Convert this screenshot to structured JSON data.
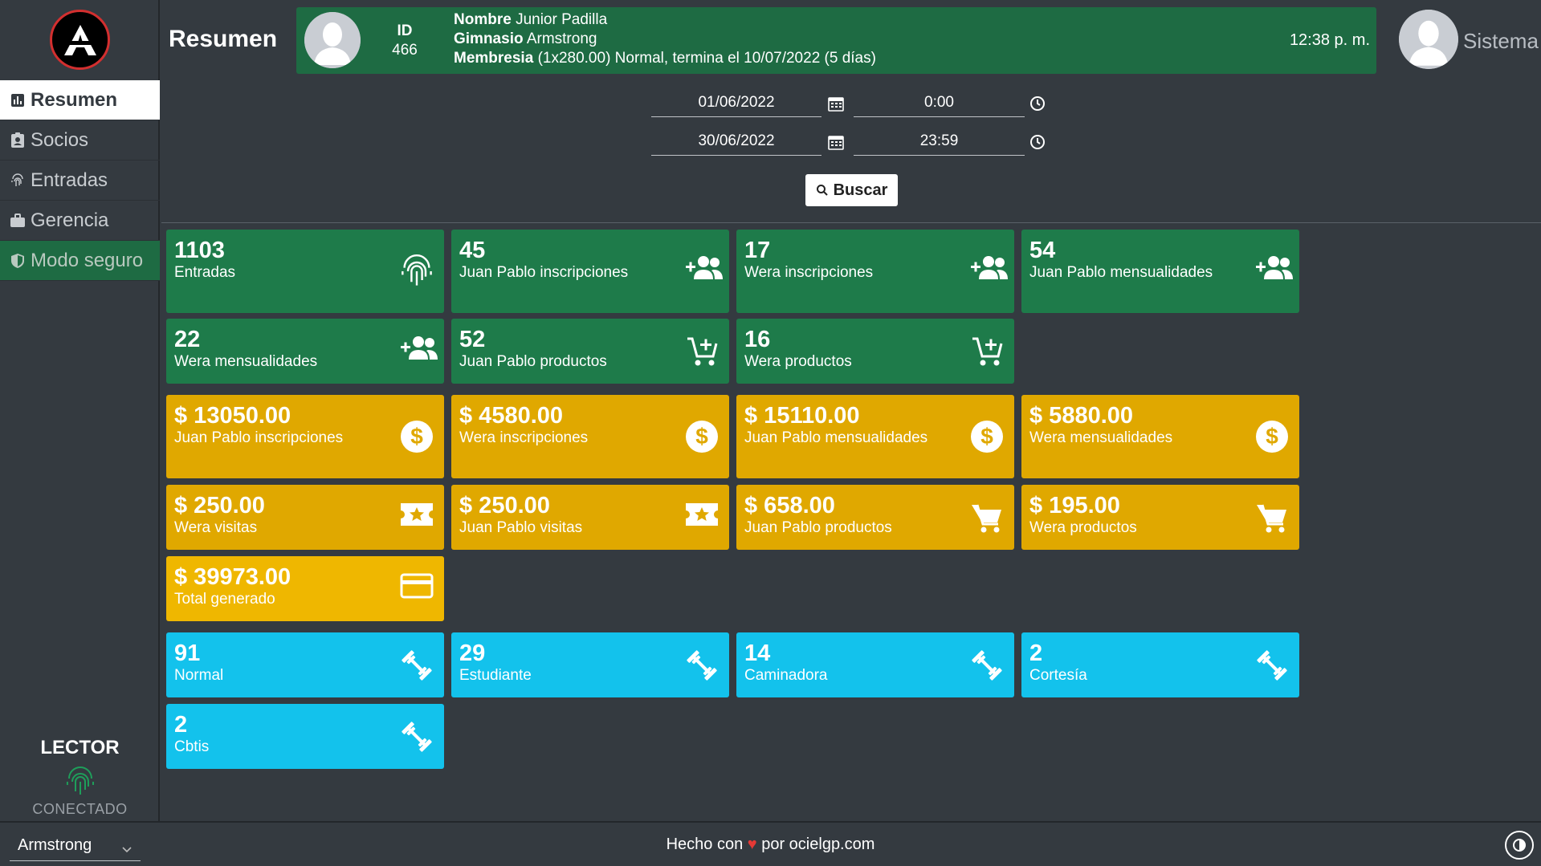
{
  "sidebar": {
    "items": [
      {
        "label": "Resumen",
        "icon": "chart-icon"
      },
      {
        "label": "Socios",
        "icon": "id-badge-icon"
      },
      {
        "label": "Entradas",
        "icon": "fingerprint-icon"
      },
      {
        "label": "Gerencia",
        "icon": "briefcase-icon"
      },
      {
        "label": "Modo seguro",
        "icon": "shield-icon"
      }
    ],
    "lector": {
      "title": "LECTOR",
      "status": "CONECTADO"
    }
  },
  "header": {
    "title": "Resumen",
    "member": {
      "id_label": "ID",
      "id_value": "466",
      "name_label": "Nombre",
      "name_value": "Junior Padilla",
      "gym_label": "Gimnasio",
      "gym_value": "Armstrong",
      "membership_label": "Membresia",
      "membership_value": "(1x280.00) Normal, termina el 10/07/2022 (5 días)",
      "time": "12:38 p. m."
    },
    "system_user": "Sistema"
  },
  "filters": {
    "start_date": "01/06/2022",
    "start_time": "0:00",
    "end_date": "30/06/2022",
    "end_time": "23:59",
    "search_label": "Buscar"
  },
  "cards": [
    {
      "value": "1103",
      "label": "Entradas",
      "color": "green",
      "icon": "fingerprint"
    },
    {
      "value": "45",
      "label": "Juan Pablo inscripciones",
      "color": "green",
      "icon": "group-add"
    },
    {
      "value": "17",
      "label": "Wera inscripciones",
      "color": "green",
      "icon": "group-add"
    },
    {
      "value": "54",
      "label": "Juan Pablo mensualidades",
      "color": "green",
      "icon": "group-add"
    },
    {
      "value": "22",
      "label": "Wera mensualidades",
      "color": "green",
      "icon": "group-add"
    },
    {
      "value": "52",
      "label": "Juan Pablo productos",
      "color": "green",
      "icon": "cart-add"
    },
    {
      "value": "16",
      "label": "Wera productos",
      "color": "green",
      "icon": "cart-add"
    },
    {
      "value": "$ 13050.00",
      "label": "Juan Pablo inscripciones",
      "color": "gold",
      "icon": "dollar"
    },
    {
      "value": "$ 4580.00",
      "label": "Wera inscripciones",
      "color": "gold",
      "icon": "dollar"
    },
    {
      "value": "$ 15110.00",
      "label": "Juan Pablo mensualidades",
      "color": "gold",
      "icon": "dollar"
    },
    {
      "value": "$ 5880.00",
      "label": "Wera mensualidades",
      "color": "gold",
      "icon": "dollar"
    },
    {
      "value": "$ 250.00",
      "label": "Wera visitas",
      "color": "gold",
      "icon": "ticket"
    },
    {
      "value": "$ 250.00",
      "label": "Juan Pablo visitas",
      "color": "gold",
      "icon": "ticket"
    },
    {
      "value": "$ 658.00",
      "label": "Juan Pablo productos",
      "color": "gold",
      "icon": "cart"
    },
    {
      "value": "$ 195.00",
      "label": "Wera productos",
      "color": "gold",
      "icon": "cart"
    },
    {
      "value": "$ 39973.00",
      "label": "Total generado",
      "color": "gold2",
      "icon": "credit-card"
    },
    {
      "value": "91",
      "label": "Normal",
      "color": "cyan",
      "icon": "dumbbell"
    },
    {
      "value": "29",
      "label": "Estudiante",
      "color": "cyan",
      "icon": "dumbbell"
    },
    {
      "value": "14",
      "label": "Caminadora",
      "color": "cyan",
      "icon": "dumbbell"
    },
    {
      "value": "2",
      "label": "Cortesía",
      "color": "cyan",
      "icon": "dumbbell"
    },
    {
      "value": "2",
      "label": "Cbtis",
      "color": "cyan",
      "icon": "dumbbell"
    }
  ],
  "footer": {
    "gym_selected": "Armstrong",
    "credit_prefix": "Hecho con",
    "heart": "♥",
    "credit_suffix": "por ocielgp.com"
  },
  "colors": {
    "green": "#1e7b4a",
    "gold": "#e0a800",
    "cyan": "#13c2ec",
    "background": "#343a40"
  }
}
